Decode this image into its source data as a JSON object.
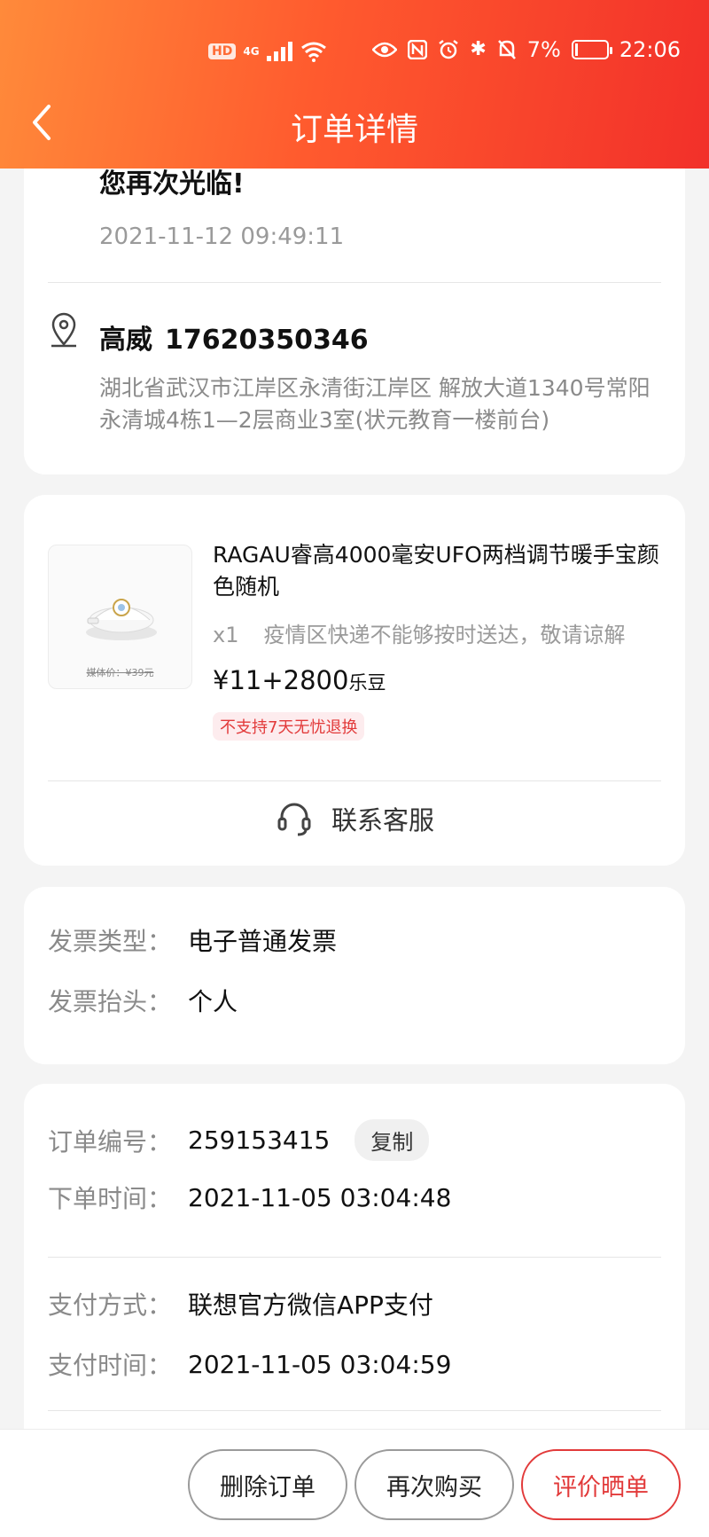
{
  "status_bar": {
    "network": "HD",
    "signal": "4G",
    "battery": "7%",
    "time": "22:06"
  },
  "header": {
    "title": "订单详情"
  },
  "order_status": {
    "thanks_text": "您再次光临!",
    "date": "2021-11-12 09:49:11"
  },
  "recipient": {
    "name": "高威",
    "phone": "17620350346",
    "address": "湖北省武汉市江岸区永清街江岸区 解放大道1340号常阳永清城4栋1—2层商业3室(状元教育一楼前台)"
  },
  "product": {
    "title": "RAGAU睿高4000毫安UFO两档调节暖手宝颜色随机",
    "quantity": "x1",
    "note": "疫情区快递不能够按时送达，敬请谅解",
    "price": "¥11+2800",
    "price_unit": "乐豆",
    "thumb_price": "媒体价：¥39元",
    "tag": "不支持7天无忧退换",
    "service_label": "联系客服"
  },
  "invoice": {
    "type_label": "发票类型：",
    "type_value": "电子普通发票",
    "title_label": "发票抬头：",
    "title_value": "个人"
  },
  "order_info": {
    "number_label": "订单编号：",
    "number_value": "259153415",
    "copy_label": "复制",
    "time_label": "下单时间：",
    "time_value": "2021-11-05 03:04:48",
    "pay_method_label": "支付方式：",
    "pay_method_value": "联想官方微信APP支付",
    "pay_time_label": "支付时间：",
    "pay_time_value": "2021-11-05 03:04:59"
  },
  "actions": {
    "delete": "删除订单",
    "rebuy": "再次购买",
    "review": "评价晒单"
  },
  "colors": {
    "header_start": "#ff8a3a",
    "header_end": "#f2302a",
    "accent": "#e23a3a"
  }
}
